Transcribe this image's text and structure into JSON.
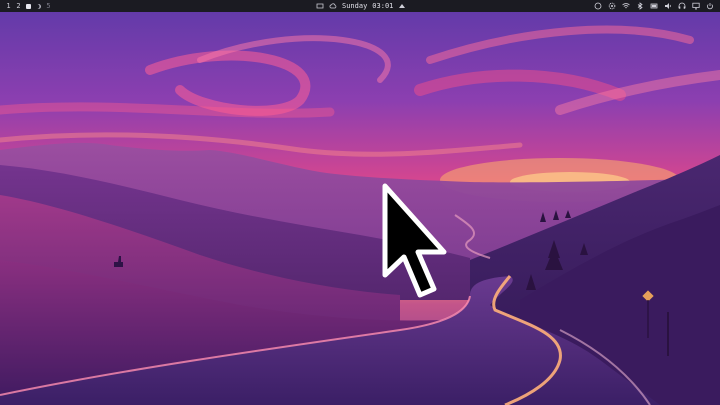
{
  "topbar": {
    "workspaces": [
      {
        "label": "1",
        "active": false
      },
      {
        "label": "2",
        "active": false
      },
      {
        "label": "",
        "active": true
      },
      {
        "label": "",
        "active": false
      },
      {
        "label": "5",
        "active": false
      }
    ],
    "clock": {
      "day": "Sunday",
      "time": "03:01"
    },
    "tray_icons": [
      "status-circle-icon",
      "settings-gear-icon",
      "wifi-icon",
      "bluetooth-icon",
      "battery-icon",
      "speaker-icon",
      "headphones-icon",
      "display-icon",
      "power-icon"
    ]
  },
  "colors": {
    "bar_bg": "#1b1b22",
    "bar_text": "#d8d8e0",
    "sky_top": "#6a3fb0",
    "sky_mid": "#e0458f",
    "sunset_glow": "#ff9a5a",
    "hills_dark": "#3a1d5c"
  }
}
